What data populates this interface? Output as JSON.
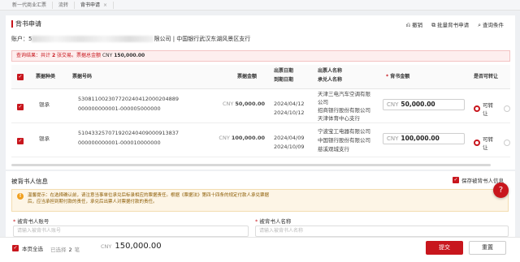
{
  "tabs": [
    {
      "label": "新一代商业汇票"
    },
    {
      "label": "流转"
    },
    {
      "label": "背书申请",
      "close": "×"
    }
  ],
  "page": {
    "title": "背书申请",
    "actions": [
      {
        "icon": "undo-icon",
        "glyph": "⎌",
        "label": "撤销"
      },
      {
        "icon": "batch-icon",
        "glyph": "⧉",
        "label": "批量背书申请"
      },
      {
        "icon": "search-icon",
        "glyph": "⌕",
        "label": "查询条件"
      }
    ],
    "account_prefix": "账户：5",
    "account_suffix": "限公司 | 中国银行武汉东湖风景区支行"
  },
  "query": {
    "prefix": "查询结果：共计",
    "count": "2",
    "mid": "张交易。票据总金额",
    "currency": "CNY",
    "total": "150,000.00"
  },
  "table": {
    "headers": {
      "type": "票据种类",
      "number": "票据号码",
      "amount": "票据金额",
      "date1": "出票日期",
      "date2": "到期日期",
      "party1": "出票人名称",
      "party2": "承兑人名称",
      "endorse_star": "*",
      "endorse": "背书金额",
      "transfer": "是否可转让"
    },
    "rows": [
      {
        "type": "银承",
        "number1": "530811002307720240412000204889",
        "number2": "000000000001-000005000000",
        "currency": "CNY",
        "amount": "50,000.00",
        "issue_date": "2024/04/12",
        "due_date": "2024/10/12",
        "drawer1": "天津三电汽车空调有限",
        "drawer2": "公司",
        "acceptor1": "招商银行股份有限公司",
        "acceptor2": "天津体育中心支行",
        "endorse_currency": "CNY",
        "endorse_amount": "50,000.00",
        "transfer_label": "可转让"
      },
      {
        "type": "银承",
        "number1": "510433257071920240409000913837",
        "number2": "000000000001-000010000000",
        "currency": "CNY",
        "amount": "100,000.00",
        "issue_date": "2024/04/09",
        "due_date": "2024/10/09",
        "drawer1": "宁波宝工电器有限公司",
        "drawer2": "",
        "acceptor1": "中国银行股份有限公司",
        "acceptor2": "慈溪观城支行",
        "endorse_currency": "CNY",
        "endorse_amount": "100,000.00",
        "transfer_label": "可转让"
      }
    ]
  },
  "endorsee": {
    "title": "被背书人信息",
    "save_label": "保存被背书人信息",
    "tip_line1": "温馨提示：在选择确认前，请注意当事单位承兑后标录相应的票据责任。根据《票据法》第四十四条的规定付款人承兑票据",
    "tip_line2": "后，应当承担到期付款的责任，承兑后出票人对票据付款的责任。",
    "account_label": "被背书人账号",
    "account_placeholder": "请输入被背书人账号",
    "name_label": "被背书人名称",
    "name_placeholder": "请输入被背书人名称",
    "required_star": "*",
    "help_glyph": "?"
  },
  "footer": {
    "select_all_label": "本页全选",
    "selected_prefix": "已选择",
    "selected_count": "2",
    "selected_unit": "笔",
    "currency": "CNY",
    "total": "150,000.00",
    "submit_label": "提交",
    "reset_label": "重置"
  },
  "colors": {
    "brand": "#c8161d",
    "tip_bg": "#fdf5e6"
  }
}
